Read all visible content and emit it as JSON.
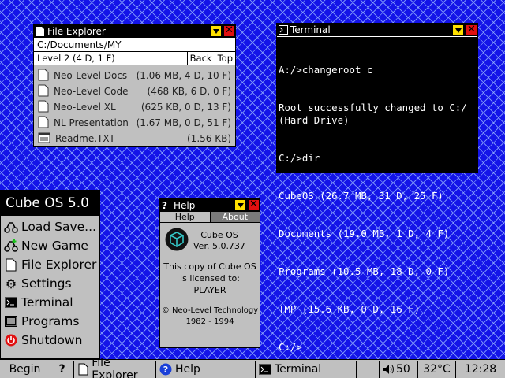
{
  "file_explorer": {
    "title": "File Explorer",
    "path": "C:/Documents/MY",
    "level": "Level 2 (4 D, 1 F)",
    "back_label": "Back",
    "top_label": "Top",
    "items": [
      {
        "name": "Neo-Level Docs",
        "info": "(1.06 MB, 4 D, 10 F)",
        "icon": "folder-icon"
      },
      {
        "name": "Neo-Level Code",
        "info": "(468 KB, 6 D, 0 F)",
        "icon": "folder-icon"
      },
      {
        "name": "Neo-Level XL",
        "info": "(625 KB, 0 D, 13 F)",
        "icon": "folder-icon"
      },
      {
        "name": "NL Presentation",
        "info": "(1.67 MB, 0 D, 51 F)",
        "icon": "folder-icon"
      },
      {
        "name": "Readme.TXT",
        "info": "(1.56 KB)",
        "icon": "text-file-icon"
      }
    ]
  },
  "terminal": {
    "title": "Terminal",
    "lines": [
      "A:/>changeroot c",
      "Root successfully changed to C:/ (Hard Drive)",
      "C:/>dir",
      "CubeOS (26.7 MB, 31 D, 25 F)",
      "Documents (19.0 MB, 1 D, 4 F)",
      "Programs (10.5 MB, 18 D, 0 F)",
      "TMP (15.6 KB, 0 D, 16 F)",
      "C:/>"
    ]
  },
  "help": {
    "title": "Help",
    "tabs": [
      "Help",
      "About"
    ],
    "product": "Cube OS",
    "version": "Ver. 5.0.737",
    "license_text": "This copy of Cube OS is licensed to:",
    "licensee": "PLAYER",
    "copyright": "© Neo-Level Technology",
    "years": "1982 - 1994"
  },
  "start_menu": {
    "title": "Cube OS 5.0",
    "items": [
      {
        "label": "Load Save...",
        "icon": "load-save-icon"
      },
      {
        "label": "New Game",
        "icon": "new-game-icon"
      },
      {
        "label": "File Explorer",
        "icon": "file-explorer-icon"
      },
      {
        "label": "Settings",
        "icon": "gear-icon"
      },
      {
        "label": "Terminal",
        "icon": "terminal-icon"
      },
      {
        "label": "Programs",
        "icon": "programs-icon"
      },
      {
        "label": "Shutdown",
        "icon": "power-icon"
      }
    ]
  },
  "taskbar": {
    "begin": "Begin",
    "help_btn": "?",
    "tasks": [
      {
        "label": "File Explorer",
        "icon": "file-icon"
      },
      {
        "label": "Help",
        "icon": "help-icon"
      },
      {
        "label": "Terminal",
        "icon": "terminal-icon"
      }
    ],
    "volume": "50",
    "temperature": "32°C",
    "clock": "12:28"
  },
  "colors": {
    "desktop": "#1414e8",
    "window_bg": "#c0c0c0",
    "titlebar": "#000000",
    "minimize": "#ffe000",
    "close": "#e01010"
  }
}
